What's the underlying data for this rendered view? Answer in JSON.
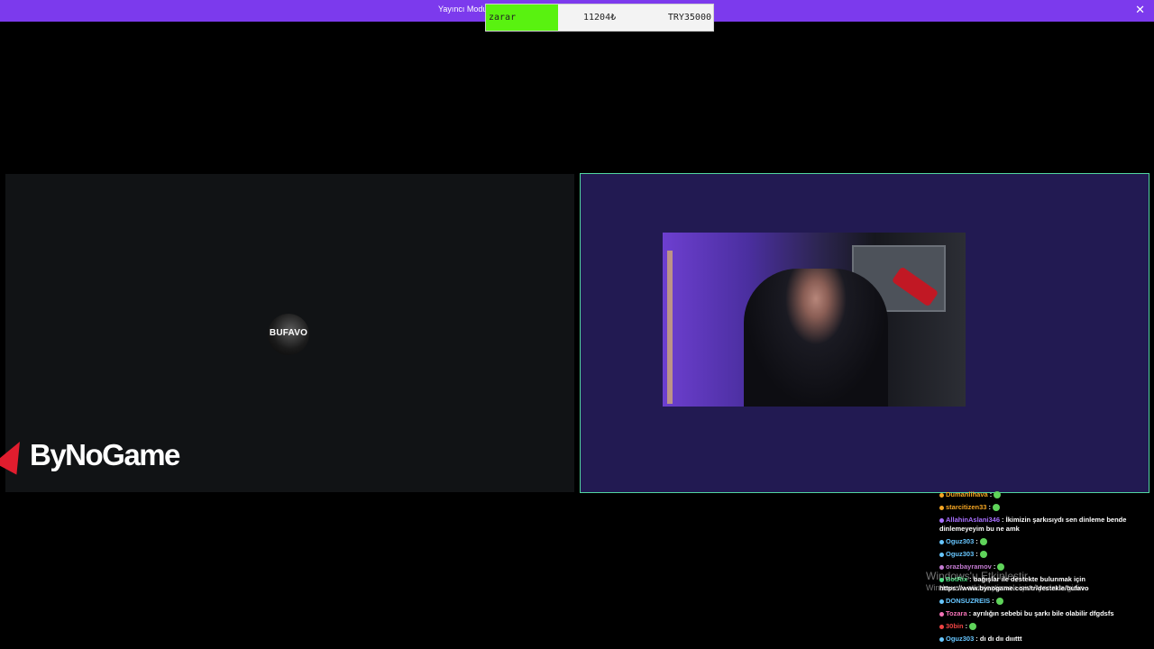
{
  "topbar": {
    "title": "Yayıncı Modu",
    "close_icon": "close-icon"
  },
  "donation_widget": {
    "status": "zarar",
    "current": "11204₺",
    "goal": "TRY35000",
    "colors": {
      "status_bg": "#59f210"
    }
  },
  "left_panel": {
    "avatar_text": "BUFAVO",
    "logo_text": "ByNoGame",
    "colors": {
      "bg": "#111315",
      "logo_mark": "#e11d2e"
    }
  },
  "right_panel": {
    "webcam": "streamer-webcam",
    "colors": {
      "bg": "#221a52",
      "border": "#52d6a0"
    }
  },
  "chat": {
    "messages": [
      {
        "user": "Dumanlihava",
        "text": "",
        "user_color": "#f5a623"
      },
      {
        "user": "starcitizen33",
        "text": "",
        "user_color": "#f5a623"
      },
      {
        "user": "AllahinAslani346",
        "text": "İkimizin şarkısıydı sen dinleme bende dinlemeyeyim bu ne amk",
        "user_color": "#a970ff"
      },
      {
        "user": "Oguz303",
        "text": "",
        "user_color": "#67c6ff"
      },
      {
        "user": "Oguz303",
        "text": "",
        "user_color": "#67c6ff"
      },
      {
        "user": "orazbayramov",
        "text": "",
        "user_color": "#c47bd2"
      },
      {
        "user": "BotRix",
        "text": "bağışlar ile destekte bulunmak için https://www.bynogame.com/tr/destekle/bufavo",
        "user_color": "#4ade80"
      },
      {
        "user": "DONSUZREIS",
        "text": "",
        "user_color": "#67c6ff"
      },
      {
        "user": "Tozara",
        "text": "ayrılığın sebebi bu şarkı bile olabilir dfgdsfs",
        "user_color": "#f472b6"
      },
      {
        "user": "30bin",
        "text": "",
        "user_color": "#ef4444"
      },
      {
        "user": "Oguz303",
        "text": "dı dı dıı dıııttt",
        "user_color": "#67c6ff"
      }
    ]
  },
  "watermark": {
    "line1": "Windows'u Etkinleştir",
    "line2": "Windows'u etkinleştirmek için Ayarlar'a gidin."
  }
}
